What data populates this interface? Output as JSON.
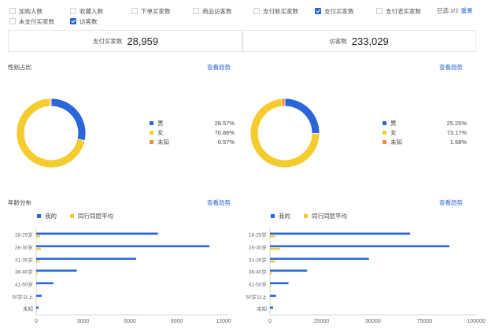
{
  "filters": {
    "row1": [
      {
        "label": "加购人数",
        "checked": false
      },
      {
        "label": "收藏人数",
        "checked": false
      },
      {
        "label": "下单买家数",
        "checked": false
      },
      {
        "label": "商品访客数",
        "checked": false
      },
      {
        "label": "支付新买家数",
        "checked": false
      },
      {
        "label": "支付买家数",
        "checked": true
      },
      {
        "label": "支付老买家数",
        "checked": false
      }
    ],
    "row2": [
      {
        "label": "未支付买家数",
        "checked": false
      },
      {
        "label": "访客数",
        "checked": true
      }
    ],
    "selected_text": "已选 2/2",
    "reset_label": "重置"
  },
  "metrics": [
    {
      "label": "支付买家数",
      "value": "28,959"
    },
    {
      "label": "访客数",
      "value": "233,029"
    }
  ],
  "gender": {
    "title": "性别占比",
    "trend_label": "查看趋势",
    "colors": {
      "男": "#2a66d8",
      "女": "#f5cc2d",
      "未知": "#f28a3c"
    },
    "left": [
      {
        "name": "男",
        "pct": "28.57%",
        "value": 28.57
      },
      {
        "name": "女",
        "pct": "70.86%",
        "value": 70.86
      },
      {
        "name": "未知",
        "pct": "0.57%",
        "value": 0.57
      }
    ],
    "right": [
      {
        "name": "男",
        "pct": "25.25%",
        "value": 25.25
      },
      {
        "name": "女",
        "pct": "73.17%",
        "value": 73.17
      },
      {
        "name": "未知",
        "pct": "1.58%",
        "value": 1.58
      }
    ]
  },
  "age": {
    "title": "年龄分布",
    "trend_label": "查看趋势",
    "legend": [
      "我的",
      "同行同层平均"
    ],
    "colors": {
      "mine": "#2a66d8",
      "avg": "#f5cc2d"
    },
    "categories": [
      "18-25岁",
      "26-30岁",
      "31-35岁",
      "36-40岁",
      "41-50岁",
      "50岁以上",
      "未知"
    ],
    "left": {
      "mine": [
        7800,
        11100,
        6400,
        2600,
        1100,
        350,
        150
      ],
      "avg": [
        250,
        300,
        200,
        80,
        40,
        20,
        10
      ],
      "ticks": [
        0,
        3000,
        6000,
        9000,
        12000
      ]
    },
    "right": {
      "mine": [
        68000,
        87000,
        48000,
        18000,
        9000,
        3000,
        1500
      ],
      "avg": [
        2500,
        5000,
        2500,
        1000,
        500,
        200,
        100
      ],
      "ticks": [
        0,
        25000,
        50000,
        75000,
        100000
      ]
    }
  }
}
